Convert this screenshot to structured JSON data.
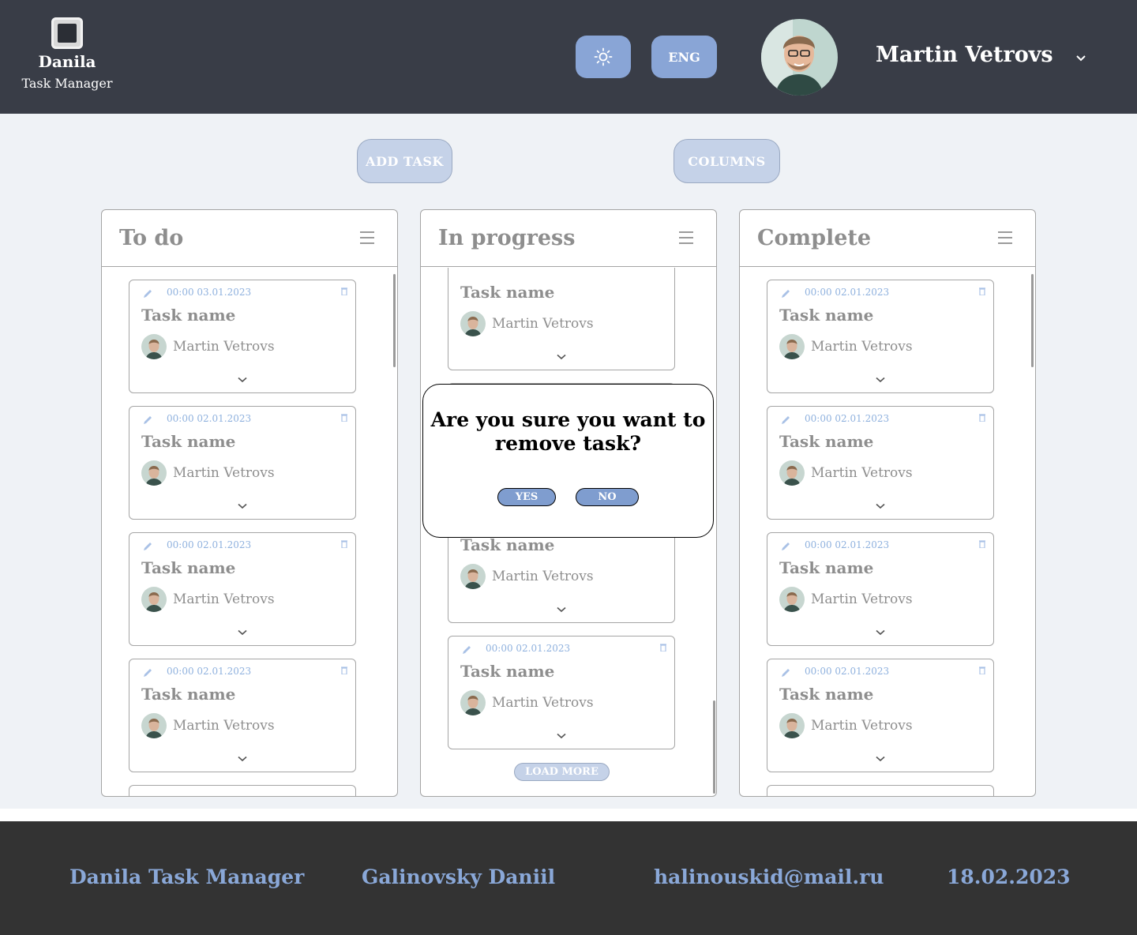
{
  "header": {
    "logo_title": "Danila",
    "logo_subtitle": "Task Manager",
    "theme_icon": "sun-icon",
    "lang_label": "ENG",
    "user_name": "Martin Vetrovs",
    "user_menu_icon": "chevron-down-icon"
  },
  "toolbar": {
    "add_task_label": "ADD TASK",
    "columns_label": "COLUMNS"
  },
  "columns": [
    {
      "title": "To do",
      "cards": [
        {
          "date": "00:00 03.01.2023",
          "name": "Task name",
          "user": "Martin Vetrovs"
        },
        {
          "date": "00:00 02.01.2023",
          "name": "Task name",
          "user": "Martin Vetrovs"
        },
        {
          "date": "00:00 02.01.2023",
          "name": "Task name",
          "user": "Martin Vetrovs"
        },
        {
          "date": "00:00 02.01.2023",
          "name": "Task name",
          "user": "Martin Vetrovs"
        }
      ]
    },
    {
      "title": "In progress",
      "cards": [
        {
          "date": "",
          "name": "Task name",
          "user": "Martin Vetrovs"
        },
        {
          "date": "",
          "name": "Task name",
          "user": "Martin Vetrovs"
        },
        {
          "date": "00:00 02.01.2023",
          "name": "Task name",
          "user": "Martin Vetrovs"
        }
      ],
      "load_more_label": "LOAD MORE"
    },
    {
      "title": "Complete",
      "cards": [
        {
          "date": "00:00 02.01.2023",
          "name": "Task name",
          "user": "Martin Vetrovs"
        },
        {
          "date": "00:00 02.01.2023",
          "name": "Task name",
          "user": "Martin Vetrovs"
        },
        {
          "date": "00:00 02.01.2023",
          "name": "Task name",
          "user": "Martin Vetrovs"
        },
        {
          "date": "00:00 02.01.2023",
          "name": "Task name",
          "user": "Martin Vetrovs"
        }
      ]
    }
  ],
  "modal": {
    "line1": "Are you sure you want to",
    "line2": "remove task?",
    "yes_label": "YES",
    "no_label": "NO"
  },
  "footer": {
    "app_name": "Danila Task Manager",
    "author": "Galinovsky Daniil",
    "email": "halinouskid@mail.ru",
    "date": "18.02.2023"
  },
  "colors": {
    "header_bg": "#393d47",
    "accent": "#89a5d6",
    "main_bg": "#eff2f6",
    "footer_bg": "#333333",
    "footer_text": "#8aa8d8",
    "date_text": "#8fb1de"
  }
}
